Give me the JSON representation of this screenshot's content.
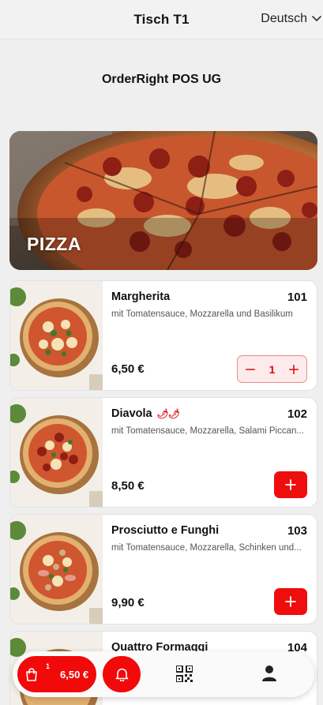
{
  "header": {
    "title": "Tisch T1",
    "language": "Deutsch",
    "icon": "chevron-down-icon"
  },
  "restaurant": {
    "name": "OrderRight POS UG"
  },
  "category": {
    "label": "PIZZA"
  },
  "menu": {
    "items": [
      {
        "name": "Margherita",
        "number": "101",
        "description": "mit Tomatensauce, Mozzarella und Basilikum",
        "price": "6,50 €",
        "quantity": "1",
        "in_cart": true,
        "spicy": false
      },
      {
        "name": "Diavola",
        "number": "102",
        "description": "mit Tomatensauce, Mozzarella, Salami Piccan...",
        "price": "8,50 €",
        "in_cart": false,
        "spicy": true
      },
      {
        "name": "Prosciutto e Funghi",
        "number": "103",
        "description": "mit Tomatensauce, Mozzarella, Schinken und...",
        "price": "9,90 €",
        "in_cart": false,
        "spicy": false
      },
      {
        "name": "Quattro Formaggi",
        "number": "104"
      }
    ]
  },
  "bottom_nav": {
    "cart_count": "1",
    "cart_total": "6,50 €",
    "icons": [
      "shopping-bag-icon",
      "bell-icon",
      "qr-code-icon",
      "user-icon"
    ]
  },
  "colors": {
    "accent": "#f20a0a",
    "stepper_bg": "#fdeaea",
    "stepper_border": "#e48d8d",
    "background": "#efefef"
  }
}
